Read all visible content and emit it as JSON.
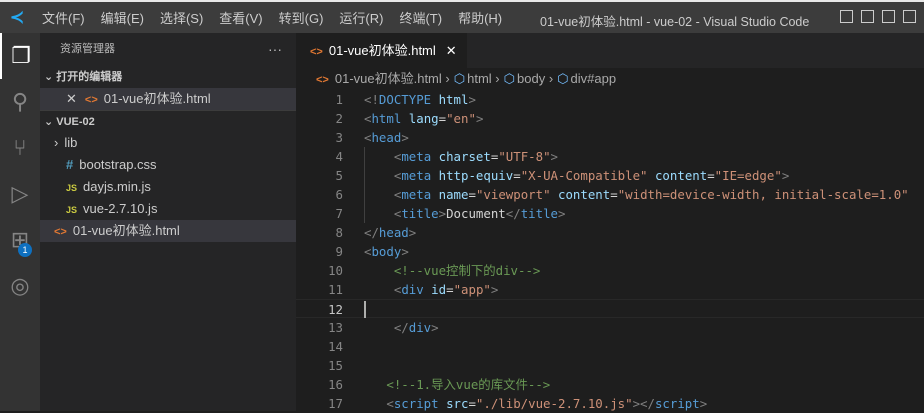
{
  "window": {
    "title": "01-vue初体验.html - vue-02 - Visual Studio Code"
  },
  "menu": [
    "文件(F)",
    "编辑(E)",
    "选择(S)",
    "查看(V)",
    "转到(G)",
    "运行(R)",
    "终端(T)",
    "帮助(H)"
  ],
  "activity": {
    "extensions_badge": "1"
  },
  "sidebar": {
    "title": "资源管理器",
    "more": "···",
    "open_editors": {
      "label": "打开的编辑器",
      "items": [
        "01-vue初体验.html"
      ]
    },
    "folder": {
      "label": "VUE-02",
      "items": [
        {
          "name": "lib",
          "type": "folder"
        },
        {
          "name": "bootstrap.css",
          "type": "css"
        },
        {
          "name": "dayjs.min.js",
          "type": "js"
        },
        {
          "name": "vue-2.7.10.js",
          "type": "js"
        },
        {
          "name": "01-vue初体验.html",
          "type": "html"
        }
      ]
    }
  },
  "editor": {
    "tab": "01-vue初体验.html",
    "breadcrumb": [
      "01-vue初体验.html",
      "html",
      "body",
      "div#app"
    ],
    "current_line": 12,
    "lines": [
      [
        [
          "<!",
          "b"
        ],
        [
          "DOCTYPE",
          "tag"
        ],
        [
          " html",
          "attr"
        ],
        [
          ">",
          "b"
        ]
      ],
      [
        [
          "<",
          "b"
        ],
        [
          "html",
          "tag"
        ],
        [
          " lang",
          "attr"
        ],
        [
          "=",
          "txt"
        ],
        [
          "\"en\"",
          "str"
        ],
        [
          ">",
          "b"
        ]
      ],
      [
        [
          "<",
          "b"
        ],
        [
          "head",
          "tag"
        ],
        [
          ">",
          "b"
        ]
      ],
      [
        [
          "    <",
          "b"
        ],
        [
          "meta",
          "tag"
        ],
        [
          " charset",
          "attr"
        ],
        [
          "=",
          "txt"
        ],
        [
          "\"UTF-8\"",
          "str"
        ],
        [
          ">",
          "b"
        ]
      ],
      [
        [
          "    <",
          "b"
        ],
        [
          "meta",
          "tag"
        ],
        [
          " http-equiv",
          "attr"
        ],
        [
          "=",
          "txt"
        ],
        [
          "\"X-UA-Compatible\"",
          "str"
        ],
        [
          " content",
          "attr"
        ],
        [
          "=",
          "txt"
        ],
        [
          "\"IE=edge\"",
          "str"
        ],
        [
          ">",
          "b"
        ]
      ],
      [
        [
          "    <",
          "b"
        ],
        [
          "meta",
          "tag"
        ],
        [
          " name",
          "attr"
        ],
        [
          "=",
          "txt"
        ],
        [
          "\"viewport\"",
          "str"
        ],
        [
          " content",
          "attr"
        ],
        [
          "=",
          "txt"
        ],
        [
          "\"width=device-width, initial-scale=1.0\"",
          "str"
        ]
      ],
      [
        [
          "    <",
          "b"
        ],
        [
          "title",
          "tag"
        ],
        [
          ">",
          "b"
        ],
        [
          "Document",
          "txt"
        ],
        [
          "</",
          "b"
        ],
        [
          "title",
          "tag"
        ],
        [
          ">",
          "b"
        ]
      ],
      [
        [
          "</",
          "b"
        ],
        [
          "head",
          "tag"
        ],
        [
          ">",
          "b"
        ]
      ],
      [
        [
          "<",
          "b"
        ],
        [
          "body",
          "tag"
        ],
        [
          ">",
          "b"
        ]
      ],
      [
        [
          "    <!--vue控制下的div-->",
          "com"
        ]
      ],
      [
        [
          "    <",
          "b"
        ],
        [
          "div",
          "tag"
        ],
        [
          " id",
          "attr"
        ],
        [
          "=",
          "txt"
        ],
        [
          "\"app\"",
          "str"
        ],
        [
          ">",
          "b"
        ]
      ],
      [],
      [
        [
          "    </",
          "b"
        ],
        [
          "div",
          "tag"
        ],
        [
          ">",
          "b"
        ]
      ],
      [],
      [],
      [
        [
          "   <!--1.导入vue的库文件-->",
          "com"
        ]
      ],
      [
        [
          "   <",
          "b"
        ],
        [
          "script",
          "tag"
        ],
        [
          " src",
          "attr"
        ],
        [
          "=",
          "txt"
        ],
        [
          "\"./lib/vue-2.7.10.js\"",
          "str"
        ],
        [
          "></",
          "b"
        ],
        [
          "script",
          "tag"
        ],
        [
          ">",
          "b"
        ]
      ]
    ]
  }
}
